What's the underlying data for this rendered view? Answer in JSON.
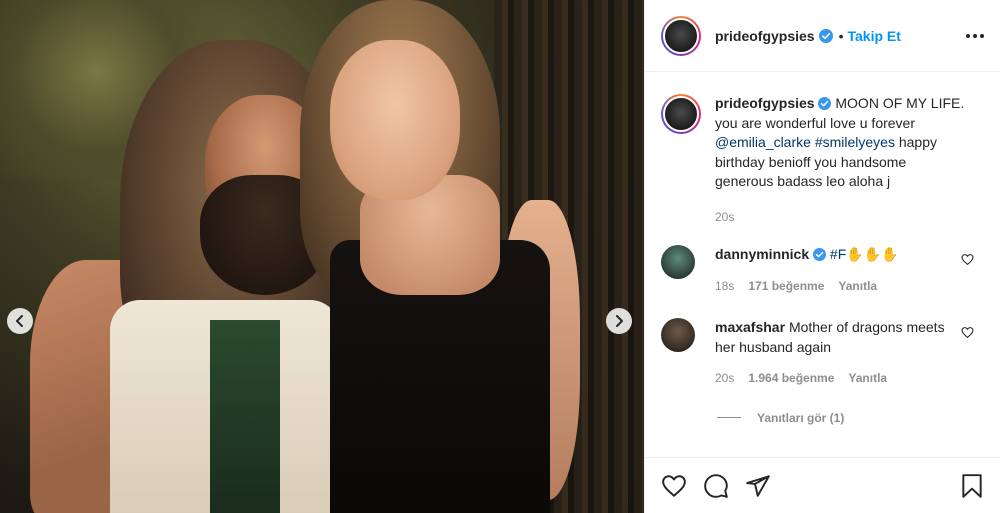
{
  "post": {
    "username": "prideofgypsies",
    "follow_label": "Takip Et",
    "dot": "•"
  },
  "caption": {
    "username": "prideofgypsies",
    "text_1": "MOON OF MY LIFE. you are wonderful love u forever ",
    "mention": "@emilia_clarke",
    "hashtag": "#smilelyeyes",
    "text_2": " happy birthday benioff you handsome generous badass leo aloha j",
    "time": "20s"
  },
  "comments": [
    {
      "username": "dannyminnick",
      "hashtag": "#F",
      "emoji": "✋✋✋",
      "time": "18s",
      "likes": "171 beğenme",
      "reply": "Yanıtla"
    },
    {
      "username": "maxafshar",
      "text": "Mother of dragons meets her husband again",
      "time": "20s",
      "likes": "1.964 beğenme",
      "reply": "Yanıtla",
      "view_replies": "Yanıtları gör (1)"
    }
  ],
  "icons": {
    "verified": "verified-badge-icon",
    "more": "more-options-icon",
    "like": "heart-icon",
    "comment": "comment-icon",
    "share": "paper-plane-icon",
    "save": "bookmark-icon",
    "prev": "chevron-left-icon",
    "next": "chevron-right-icon"
  },
  "colors": {
    "link": "#00376b",
    "follow": "#0095f6",
    "verified": "#3897f0",
    "muted": "#8e8e8e"
  }
}
